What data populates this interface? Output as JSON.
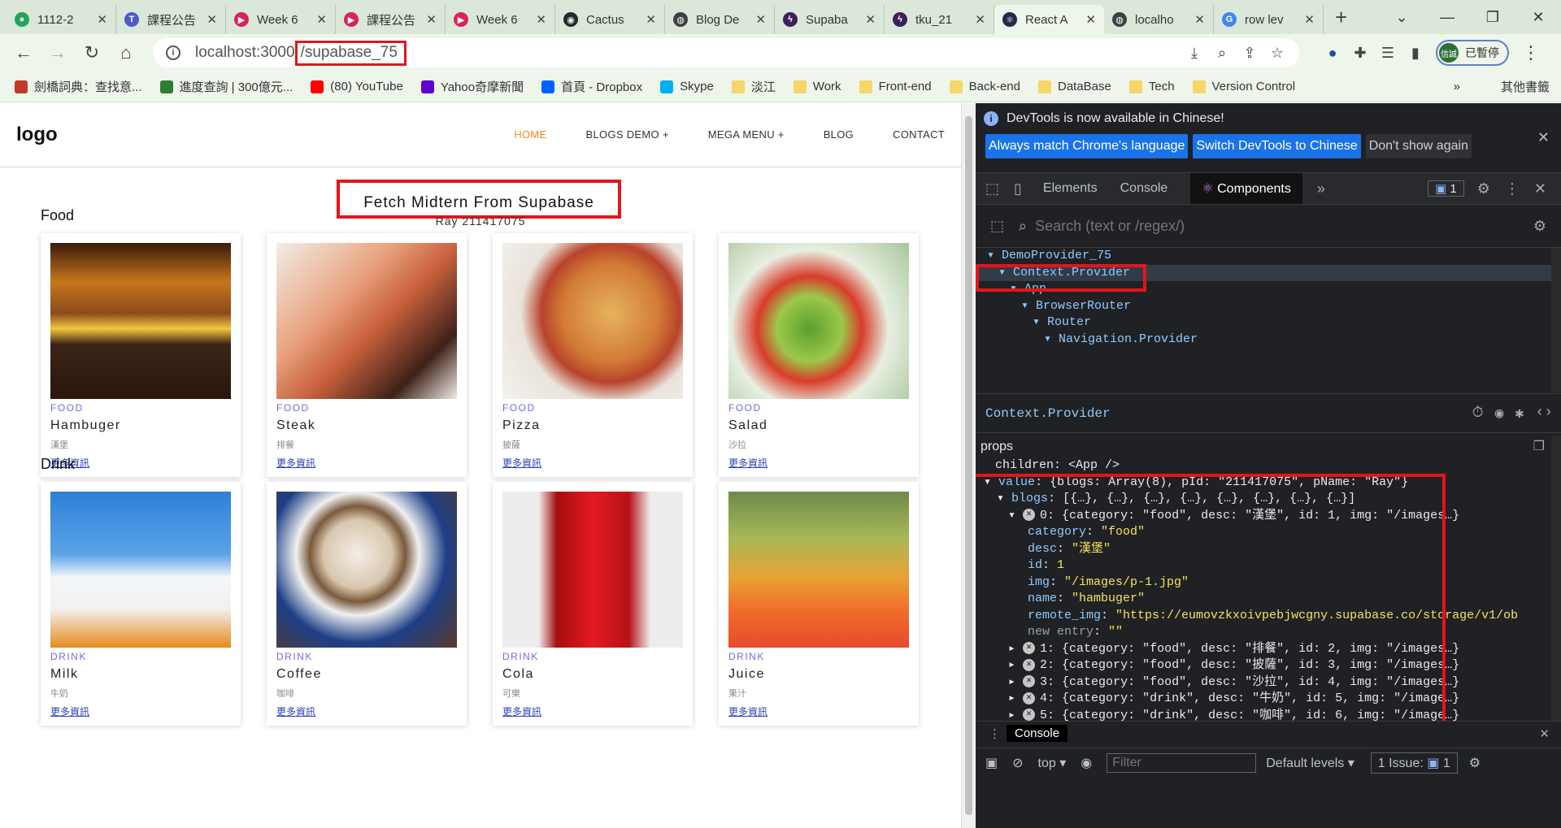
{
  "browser": {
    "tabs": [
      {
        "title": "1112-2",
        "fav_color": "#22a45d",
        "fav_glyph": "●"
      },
      {
        "title": "課程公告",
        "fav_color": "#5059c9",
        "fav_glyph": "T"
      },
      {
        "title": "Week 6",
        "fav_color": "#d9235f",
        "fav_glyph": "▶"
      },
      {
        "title": "課程公告",
        "fav_color": "#d9235f",
        "fav_glyph": "▶"
      },
      {
        "title": "Week 6",
        "fav_color": "#d9235f",
        "fav_glyph": "▶"
      },
      {
        "title": "Cactus",
        "fav_color": "#24292f",
        "fav_glyph": "◉"
      },
      {
        "title": "Blog De",
        "fav_color": "#3c4043",
        "fav_glyph": "◍"
      },
      {
        "title": "Supaba",
        "fav_color": "#3b1f5e",
        "fav_glyph": "ϟ"
      },
      {
        "title": "tku_21",
        "fav_color": "#3b1f5e",
        "fav_glyph": "ϟ"
      },
      {
        "title": "React A",
        "fav_color": "#1f2a44",
        "fav_glyph": "⚛",
        "active": true
      },
      {
        "title": "localho",
        "fav_color": "#3c4043",
        "fav_glyph": "◍"
      },
      {
        "title": "row lev",
        "fav_color": "#4285f4",
        "fav_glyph": "G"
      }
    ],
    "new_tab_glyph": "+",
    "url_host": "localhost:3000",
    "url_path": "/supabase_75",
    "profile_initials": "信誠",
    "profile_label": "已暫停",
    "bookmarks": [
      {
        "label": "劍橋詞典：查找意...",
        "color": "#c0392b"
      },
      {
        "label": "進度查詢 | 300億元...",
        "color": "#2e7d32"
      },
      {
        "label": "(80) YouTube",
        "color": "#ff0000"
      },
      {
        "label": "Yahoo奇摩新聞",
        "color": "#6001d2"
      },
      {
        "label": "首頁 - Dropbox",
        "color": "#0061ff"
      },
      {
        "label": "Skype",
        "color": "#00aff0"
      },
      {
        "label": "淡江",
        "color": "folder"
      },
      {
        "label": "Work",
        "color": "folder"
      },
      {
        "label": "Front-end",
        "color": "folder"
      },
      {
        "label": "Back-end",
        "color": "folder"
      },
      {
        "label": "DataBase",
        "color": "folder"
      },
      {
        "label": "Tech",
        "color": "folder"
      },
      {
        "label": "Version Control",
        "color": "folder"
      }
    ],
    "bookmarks_more": "»",
    "other_bookmarks": "其他書籤"
  },
  "site": {
    "logo": "logo",
    "nav": [
      "HOME",
      "BLOGS DEMO +",
      "MEGA MENU +",
      "BLOG",
      "CONTACT"
    ],
    "title": "Fetch Midtern From Supabase",
    "subtitle": "Ray 211417075",
    "sections": [
      {
        "title": "Food",
        "items": [
          {
            "category": "FOOD",
            "name": "Hambuger",
            "desc": "漢堡",
            "more": "更多資訊",
            "img_bg": "linear-gradient(180deg,#3a1a0a 0%,#c9761c 25%,#8b4a1d 45%,#f4c63d 55%,#3b2418 65%,#2a160c 100%)"
          },
          {
            "category": "FOOD",
            "name": "Steak",
            "desc": "排餐",
            "more": "更多資訊",
            "img_bg": "linear-gradient(135deg,#f2eee9 0%,#e8a27d 35%,#c9603d 55%,#3e2218 80%,#f1ece7 100%)"
          },
          {
            "category": "FOOD",
            "name": "Pizza",
            "desc": "披薩",
            "more": "更多資訊",
            "img_bg": "radial-gradient(circle at 60% 45%,#e7b35e 0%,#d27b36 35%,#b8432b 50%,#e9e3db 65%,#f4f2ef 100%)"
          },
          {
            "category": "FOOD",
            "name": "Salad",
            "desc": "沙拉",
            "more": "更多資訊",
            "img_bg": "radial-gradient(circle at 45% 55%,#5c9e2f 0%,#9cc84a 25%,#d83c2a 40%,#e7efe1 60%,#a8c59b 100%)"
          }
        ]
      },
      {
        "title": "Drink",
        "items": [
          {
            "category": "DRINK",
            "name": "Milk",
            "desc": "牛奶",
            "more": "更多資訊",
            "img_bg": "linear-gradient(180deg,#2d7fd8 0%,#5aa3e9 40%,#f4f6f8 55%,#f1f1f1 75%,#e68a1d 100%)"
          },
          {
            "category": "DRINK",
            "name": "Coffee",
            "desc": "咖啡",
            "more": "更多資訊",
            "img_bg": "radial-gradient(circle at 45% 40%,#f3eee6 0%,#d9c7ae 25%,#7a5a3d 35%,#f0f0f0 45%,#1e3f86 65%,#5a3a2a 100%)"
          },
          {
            "category": "DRINK",
            "name": "Cola",
            "desc": "可樂",
            "more": "更多資訊",
            "img_bg": "linear-gradient(90deg,#ededed 0%,#ededed 20%,#a40f12 30%,#e21a1f 50%,#b71217 70%,#ededed 82%,#ededed 100%)"
          },
          {
            "category": "DRINK",
            "name": "Juice",
            "desc": "果汁",
            "more": "更多資訊",
            "img_bg": "linear-gradient(180deg,#6d8a4a 0%,#a9b857 30%,#e8a235 55%,#f06f2a 75%,#e84a2d 100%)"
          }
        ]
      }
    ]
  },
  "devtools": {
    "banner_text": "DevTools is now available in Chinese!",
    "banner_btn1": "Always match Chrome's language",
    "banner_btn2": "Switch DevTools to Chinese",
    "banner_btn3": "Don't show again",
    "tabs": [
      "Elements",
      "Console",
      "Components"
    ],
    "tabs_more": "»",
    "issues_count": "1",
    "search_placeholder": "Search (text or /regex/)",
    "tree": [
      {
        "label": "▾ DemoProvider_75",
        "indent": 14
      },
      {
        "label": "▾ Context.Provider",
        "indent": 28,
        "selected": true
      },
      {
        "label": "▾ App",
        "indent": 42
      },
      {
        "label": "▾ BrowserRouter",
        "indent": 56
      },
      {
        "label": "▾ Router",
        "indent": 70
      },
      {
        "label": "▾ Navigation.Provider",
        "indent": 84
      }
    ],
    "selected_component": "Context.Provider",
    "props_heading": "props",
    "children_line": "children: <App />",
    "value_key": "value",
    "value_summary": "{blogs: Array(8), pId: \"211417075\", pName: \"Ray\"}",
    "blogs_key": "blogs",
    "blogs_summary": "[{…}, {…}, {…}, {…}, {…}, {…}, {…}, {…}]",
    "item0_summary": "0: {category: \"food\", desc: \"漢堡\", id: 1, img: \"/images…}",
    "item0_fields": [
      {
        "key": "category",
        "value": "\"food\""
      },
      {
        "key": "desc",
        "value": "\"漢堡\""
      },
      {
        "key": "id",
        "value": "1"
      },
      {
        "key": "img",
        "value": "\"/images/p-1.jpg\""
      },
      {
        "key": "name",
        "value": "\"hambuger\""
      },
      {
        "key": "remote_img",
        "value": "\"https://eumovzkxoivpebjwcgny.supabase.co/storage/v1/ob"
      },
      {
        "key": "new entry",
        "value": "\"\"",
        "dim": true
      }
    ],
    "more_items": [
      "1: {category: \"food\", desc: \"排餐\", id: 2, img: \"/images…}",
      "2: {category: \"food\", desc: \"披薩\", id: 3, img: \"/images…}",
      "3: {category: \"food\", desc: \"沙拉\", id: 4, img: \"/images…}",
      "4: {category: \"drink\", desc: \"牛奶\", id: 5, img: \"/image…}",
      "5: {category: \"drink\", desc: \"咖啡\", id: 6, img: \"/image…}"
    ],
    "drawer_tab": "Console",
    "context": "top",
    "filter_placeholder": "Filter",
    "levels": "Default levels",
    "issue_label": "1 Issue:",
    "issue_count": "1"
  }
}
